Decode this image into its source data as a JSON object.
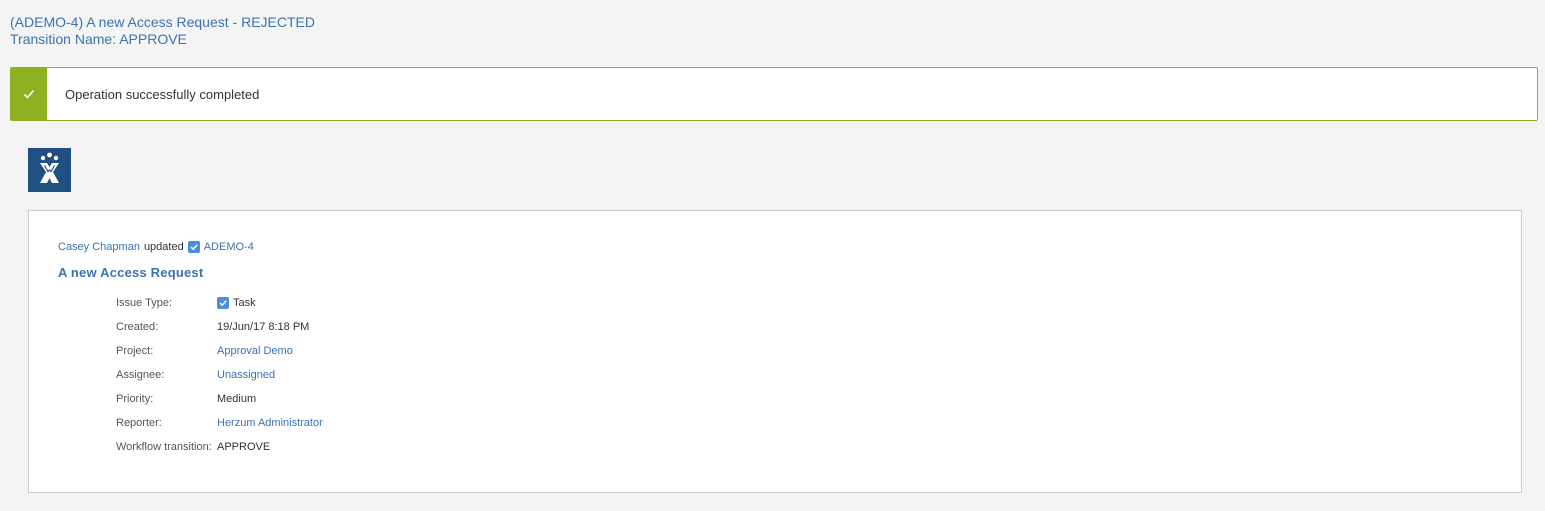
{
  "header": {
    "title": "(ADEMO-4) A new Access Request - REJECTED",
    "subtitle": "Transition Name: APPROVE"
  },
  "alert": {
    "message": "Operation successfully completed",
    "icon": "check-icon",
    "color": "#8eb021"
  },
  "logo": {
    "icon": "jira-logo-icon",
    "color": "#205081"
  },
  "activity": {
    "user": "Casey Chapman",
    "verb": "updated",
    "issue_key": "ADEMO-4",
    "issue_title": "A new Access Request"
  },
  "fields": [
    {
      "label": "Issue Type:",
      "value": "Task",
      "icon": "task-icon",
      "link": false
    },
    {
      "label": "Created:",
      "value": "19/Jun/17 8:18 PM",
      "link": false
    },
    {
      "label": "Project:",
      "value": "Approval Demo",
      "link": true
    },
    {
      "label": "Assignee:",
      "value": "Unassigned",
      "link": true
    },
    {
      "label": "Priority:",
      "value": "Medium",
      "link": false
    },
    {
      "label": "Reporter:",
      "value": "Herzum Administrator",
      "link": true
    },
    {
      "label": "Workflow transition:",
      "value": "APPROVE",
      "link": false
    }
  ],
  "colors": {
    "link": "#3b73af",
    "border": "#cccccc",
    "background": "#f4f4f4"
  }
}
